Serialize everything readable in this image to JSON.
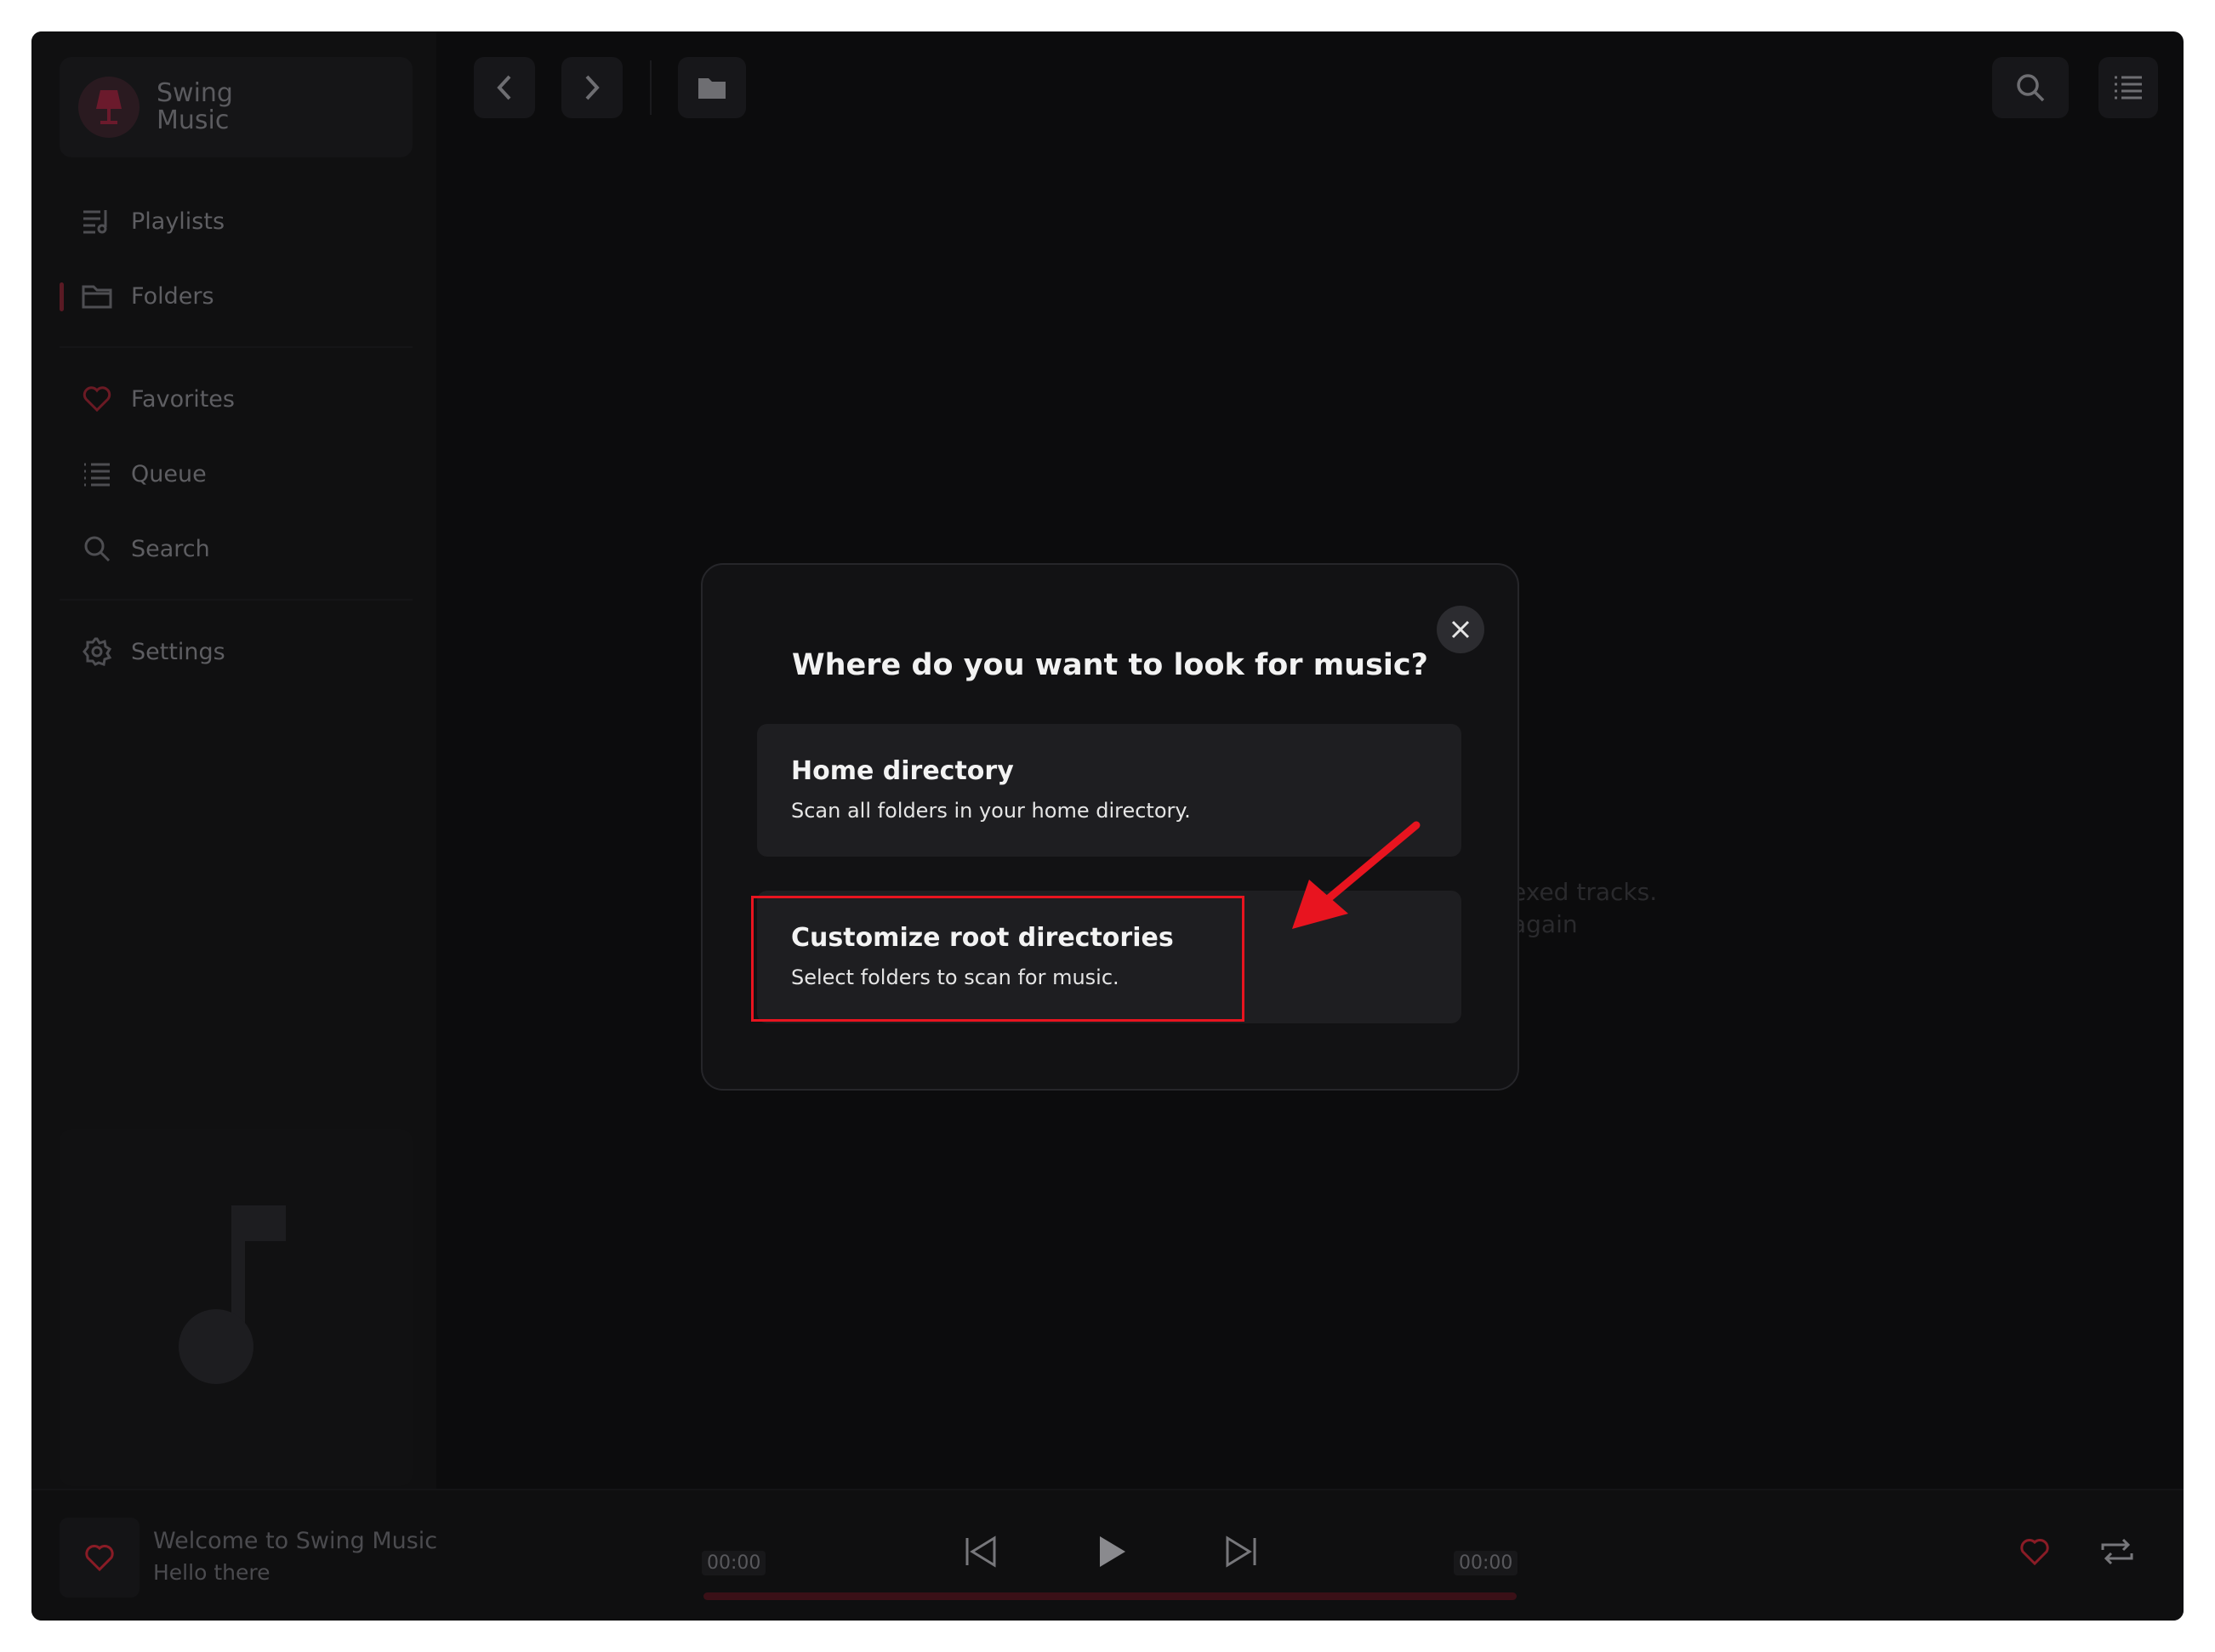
{
  "app": {
    "name_line1": "Swing",
    "name_line2": "Music"
  },
  "sidebar": {
    "items": [
      {
        "label": "Playlists"
      },
      {
        "label": "Folders"
      },
      {
        "label": "Favorites"
      },
      {
        "label": "Queue"
      },
      {
        "label": "Search"
      },
      {
        "label": "Settings"
      }
    ]
  },
  "background_text": {
    "line1": "exed tracks.",
    "line2": "again"
  },
  "modal": {
    "title": "Where do you want to look for music?",
    "options": [
      {
        "title": "Home directory",
        "subtitle": "Scan all folders in your home directory."
      },
      {
        "title": "Customize root directories",
        "subtitle": "Select folders to scan for music."
      }
    ]
  },
  "player": {
    "title": "Welcome to Swing Music",
    "artist": "Hello there",
    "time_elapsed": "00:00",
    "time_total": "00:00"
  },
  "colors": {
    "accent": "#e8141f",
    "background": "#0c0c0d",
    "modal": "#121214",
    "card": "#1e1e21"
  }
}
